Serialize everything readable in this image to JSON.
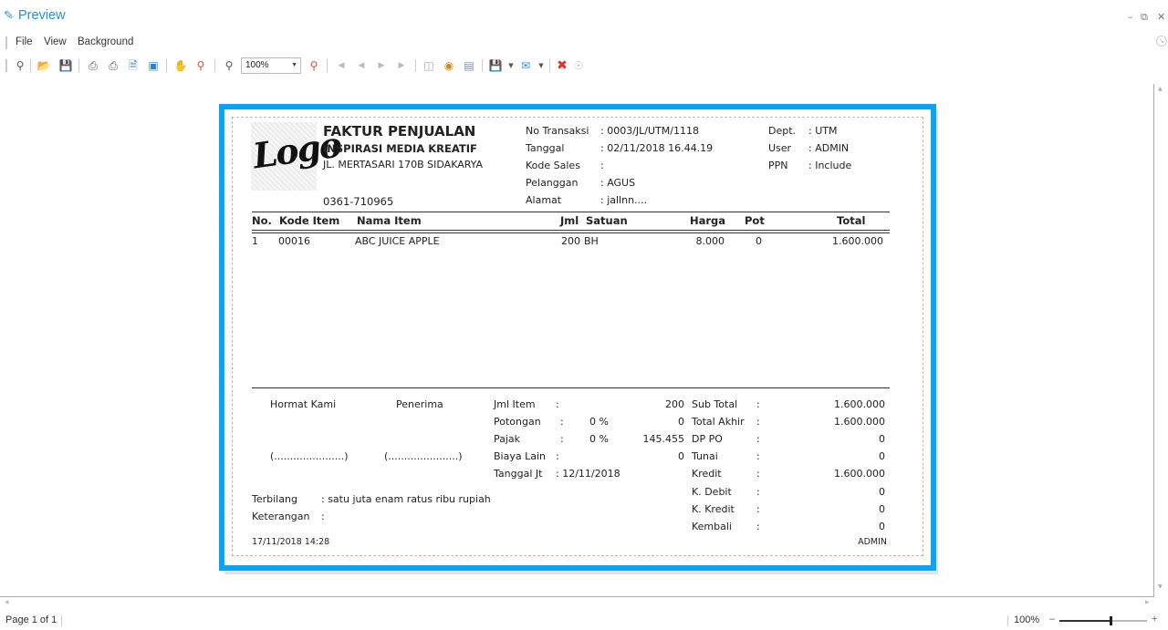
{
  "window": {
    "title": "Preview",
    "icons": {
      "app": "preview-icon",
      "minimize": "minimize-icon",
      "restore": "restore-icon",
      "close": "close-icon"
    }
  },
  "menu": {
    "items": [
      {
        "label": "File"
      },
      {
        "label": "View"
      },
      {
        "label": "Background"
      }
    ]
  },
  "toolbar": {
    "zoom_value": "100%",
    "buttons": [
      "find-icon",
      "open-icon",
      "save-icon",
      "print-dialog-icon",
      "print-icon",
      "page-setup-icon",
      "scale-icon",
      "hand-tool-icon",
      "magnifier-icon",
      "zoom-out-icon",
      "zoom-in-icon",
      "first-page-icon",
      "previous-page-icon",
      "next-page-icon",
      "last-page-icon",
      "multiple-pages-icon",
      "color-icon",
      "watermark-icon",
      "export-icon",
      "email-icon",
      "close-preview-icon",
      "collapse-icon"
    ]
  },
  "invoice": {
    "logo_text": "Logo",
    "title": "FAKTUR PENJUALAN",
    "company": "INSPIRASI MEDIA KREATIF",
    "address": "JL. MERTASARI 170B SIDAKARYA",
    "phone": "0361-710965",
    "info": [
      {
        "label": "No Transaksi",
        "value": ": 0003/JL/UTM/1118"
      },
      {
        "label": "Tanggal",
        "value": ": 02/11/2018 16.44.19"
      },
      {
        "label": "Kode Sales",
        "value": ":"
      },
      {
        "label": "Pelanggan",
        "value": ": AGUS"
      },
      {
        "label": "Alamat",
        "value": ": jallnn...."
      }
    ],
    "info_right": [
      {
        "label": "Dept.",
        "value": ": UTM"
      },
      {
        "label": "User",
        "value": ": ADMIN"
      },
      {
        "label": "PPN",
        "value": ": Include"
      }
    ],
    "columns": {
      "no": "No.",
      "kode": "Kode Item",
      "nama": "Nama Item",
      "jml": "Jml",
      "satuan": "Satuan",
      "harga": "Harga",
      "pot": "Pot",
      "total": "Total"
    },
    "items": [
      {
        "no": "1",
        "kode": "00016",
        "nama": "ABC JUICE APPLE",
        "jml": "200",
        "satuan": "BH",
        "harga": "8.000",
        "pot": "0",
        "total": "1.600.000"
      }
    ],
    "signatures": {
      "left_label": "Hormat Kami",
      "right_label": "Penerima",
      "left_line": "(......................)",
      "right_line": "(......................)"
    },
    "summary_mid": [
      {
        "label": "Jml Item",
        "colon": ":",
        "pct": "",
        "value": "200"
      },
      {
        "label": "Potongan",
        "colon": ":",
        "pct": "0 %",
        "value": "0"
      },
      {
        "label": "Pajak",
        "colon": ":",
        "pct": "0 %",
        "value": "145.455"
      },
      {
        "label": "Biaya Lain",
        "colon": ":",
        "pct": "",
        "value": "0"
      },
      {
        "label": "Tanggal Jt",
        "colon": ": 12/11/2018",
        "pct": "",
        "value": ""
      }
    ],
    "summary_right": [
      {
        "label": "Sub Total",
        "value": "1.600.000"
      },
      {
        "label": "Total Akhir",
        "value": "1.600.000"
      },
      {
        "label": "DP PO",
        "value": "0"
      },
      {
        "label": "Tunai",
        "value": "0"
      },
      {
        "label": "Kredit",
        "value": "1.600.000"
      },
      {
        "label": "K. Debit",
        "value": "0"
      },
      {
        "label": "K. Kredit",
        "value": "0"
      },
      {
        "label": "Kembali",
        "value": "0"
      }
    ],
    "terbilang_label": "Terbilang",
    "terbilang_value": ": satu juta enam ratus ribu rupiah",
    "keterangan_label": "Keterangan",
    "keterangan_value": ":",
    "printed_at": "17/11/2018 14:28",
    "printed_by": "ADMIN"
  },
  "status": {
    "page": "Page 1 of 1",
    "zoom": "100%",
    "zoom_fraction": 0.58,
    "zoom_minus": "–",
    "zoom_plus": "+"
  }
}
